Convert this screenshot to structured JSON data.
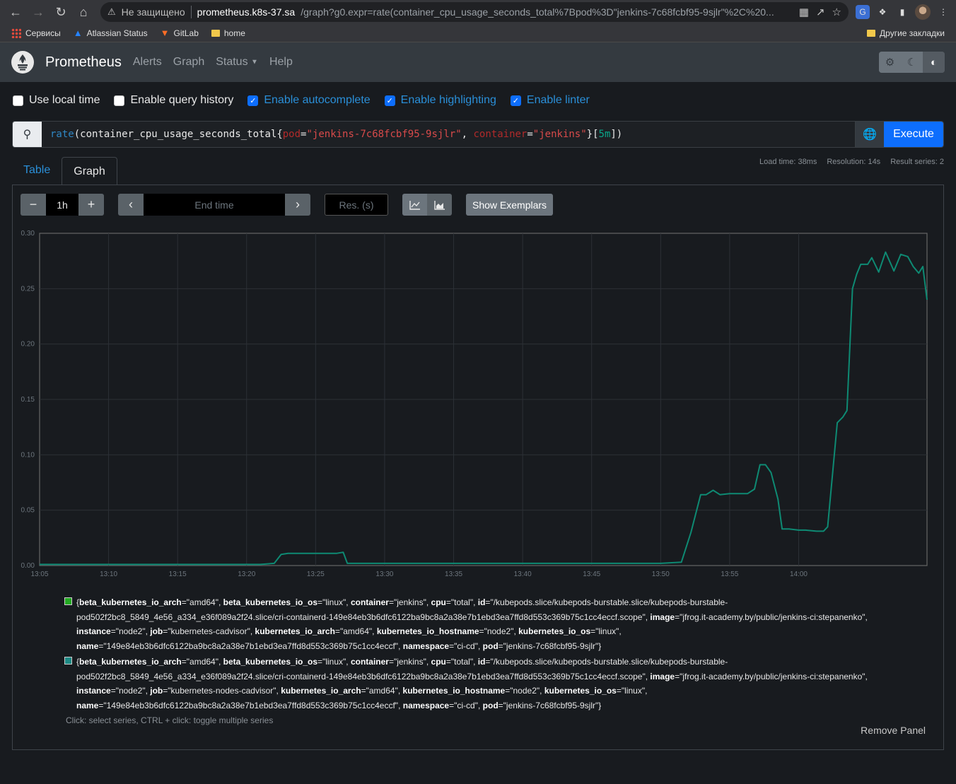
{
  "browser": {
    "insecure_label": "Не защищено",
    "host": "prometheus.k8s-37.sa",
    "path": "/graph?g0.expr=rate(container_cpu_usage_seconds_total%7Bpod%3D\"jenkins-7c68fcbf95-9sjlr\"%2C%20...",
    "bookmarks": [
      "Сервисы",
      "Atlassian Status",
      "GitLab",
      "home"
    ],
    "other_bookmarks": "Другие закладки"
  },
  "navbar": {
    "brand": "Prometheus",
    "links": [
      "Alerts",
      "Graph",
      "Status",
      "Help"
    ]
  },
  "options": [
    {
      "label": "Use local time",
      "checked": false
    },
    {
      "label": "Enable query history",
      "checked": false
    },
    {
      "label": "Enable autocomplete",
      "checked": true
    },
    {
      "label": "Enable highlighting",
      "checked": true
    },
    {
      "label": "Enable linter",
      "checked": true
    }
  ],
  "query": {
    "fn": "rate",
    "metric": "container_cpu_usage_seconds_total",
    "label1": "pod",
    "value1": "\"jenkins-7c68fcbf95-9sjlr\"",
    "label2": "container",
    "value2": "\"jenkins\"",
    "range": "5m",
    "execute_label": "Execute"
  },
  "tabs": {
    "table": "Table",
    "graph": "Graph"
  },
  "stats": {
    "load_time": "Load time: 38ms",
    "resolution": "Resolution: 14s",
    "result_series": "Result series: 2"
  },
  "controls": {
    "range": "1h",
    "end_time_placeholder": "End time",
    "res_placeholder": "Res. (s)",
    "show_exemplars": "Show Exemplars"
  },
  "chart_data": {
    "type": "line",
    "x_tick_labels": [
      "13:05",
      "13:10",
      "13:15",
      "13:20",
      "13:25",
      "13:30",
      "13:35",
      "13:40",
      "13:45",
      "13:50",
      "13:55",
      "14:00"
    ],
    "y_tick_labels": [
      "0.00",
      "0.05",
      "0.10",
      "0.15",
      "0.20",
      "0.25",
      "0.30"
    ],
    "ylim": [
      0,
      0.3
    ],
    "x_unit": "minutes after 13:05",
    "series": [
      {
        "color": "#0e8a73",
        "points": [
          [
            0,
            0.001
          ],
          [
            5,
            0.001
          ],
          [
            10,
            0.001
          ],
          [
            15,
            0.001
          ],
          [
            16,
            0.001
          ],
          [
            17,
            0.002
          ],
          [
            17.5,
            0.01
          ],
          [
            18,
            0.011
          ],
          [
            20,
            0.011
          ],
          [
            21.5,
            0.011
          ],
          [
            22,
            0.012
          ],
          [
            22.3,
            0.002
          ],
          [
            25,
            0.002
          ],
          [
            30,
            0.002
          ],
          [
            35,
            0.002
          ],
          [
            40,
            0.002
          ],
          [
            45,
            0.002
          ],
          [
            46.5,
            0.003
          ],
          [
            47.2,
            0.03
          ],
          [
            47.9,
            0.064
          ],
          [
            48.3,
            0.064
          ],
          [
            48.8,
            0.068
          ],
          [
            49.3,
            0.064
          ],
          [
            50,
            0.065
          ],
          [
            51.3,
            0.065
          ],
          [
            51.8,
            0.069
          ],
          [
            52.2,
            0.091
          ],
          [
            52.6,
            0.091
          ],
          [
            53,
            0.084
          ],
          [
            53.5,
            0.06
          ],
          [
            53.8,
            0.033
          ],
          [
            54.3,
            0.033
          ],
          [
            55,
            0.032
          ],
          [
            55.5,
            0.032
          ],
          [
            56.3,
            0.031
          ],
          [
            56.8,
            0.031
          ],
          [
            57.1,
            0.035
          ],
          [
            57.8,
            0.129
          ],
          [
            58.2,
            0.134
          ],
          [
            58.5,
            0.14
          ],
          [
            58.9,
            0.25
          ],
          [
            59.2,
            0.263
          ],
          [
            59.5,
            0.272
          ],
          [
            60,
            0.272
          ],
          [
            60.3,
            0.278
          ],
          [
            60.8,
            0.265
          ],
          [
            61.3,
            0.283
          ],
          [
            61.9,
            0.266
          ],
          [
            62.4,
            0.281
          ],
          [
            62.9,
            0.279
          ],
          [
            63.3,
            0.27
          ],
          [
            63.7,
            0.264
          ],
          [
            64,
            0.27
          ],
          [
            64.3,
            0.24
          ]
        ]
      }
    ]
  },
  "legend": [
    {
      "color": "#22aa22",
      "parts": [
        [
          "beta_kubernetes_io_arch",
          "\"amd64\""
        ],
        [
          "beta_kubernetes_io_os",
          "\"linux\""
        ],
        [
          "container",
          "\"jenkins\""
        ],
        [
          "cpu",
          "\"total\""
        ],
        [
          "id",
          "\"/kubepods.slice/kubepods-burstable.slice/kubepods-burstable-pod502f2bc8_5849_4e56_a334_e36f089a2f24.slice/cri-containerd-149e84eb3b6dfc6122ba9bc8a2a38e7b1ebd3ea7ffd8d553c369b75c1cc4eccf.scope\""
        ],
        [
          "image",
          "\"jfrog.it-academy.by/public/jenkins-ci:stepanenko\""
        ],
        [
          "instance",
          "\"node2\""
        ],
        [
          "job",
          "\"kubernetes-cadvisor\""
        ],
        [
          "kubernetes_io_arch",
          "\"amd64\""
        ],
        [
          "kubernetes_io_hostname",
          "\"node2\""
        ],
        [
          "kubernetes_io_os",
          "\"linux\""
        ],
        [
          "name",
          "\"149e84eb3b6dfc6122ba9bc8a2a38e7b1ebd3ea7ffd8d553c369b75c1cc4eccf\""
        ],
        [
          "namespace",
          "\"ci-cd\""
        ],
        [
          "pod",
          "\"jenkins-7c68fcbf95-9sjlr\""
        ]
      ]
    },
    {
      "color": "#1c8a84",
      "parts": [
        [
          "beta_kubernetes_io_arch",
          "\"amd64\""
        ],
        [
          "beta_kubernetes_io_os",
          "\"linux\""
        ],
        [
          "container",
          "\"jenkins\""
        ],
        [
          "cpu",
          "\"total\""
        ],
        [
          "id",
          "\"/kubepods.slice/kubepods-burstable.slice/kubepods-burstable-pod502f2bc8_5849_4e56_a334_e36f089a2f24.slice/cri-containerd-149e84eb3b6dfc6122ba9bc8a2a38e7b1ebd3ea7ffd8d553c369b75c1cc4eccf.scope\""
        ],
        [
          "image",
          "\"jfrog.it-academy.by/public/jenkins-ci:stepanenko\""
        ],
        [
          "instance",
          "\"node2\""
        ],
        [
          "job",
          "\"kubernetes-nodes-cadvisor\""
        ],
        [
          "kubernetes_io_arch",
          "\"amd64\""
        ],
        [
          "kubernetes_io_hostname",
          "\"node2\""
        ],
        [
          "kubernetes_io_os",
          "\"linux\""
        ],
        [
          "name",
          "\"149e84eb3b6dfc6122ba9bc8a2a38e7b1ebd3ea7ffd8d553c369b75c1cc4eccf\""
        ],
        [
          "namespace",
          "\"ci-cd\""
        ],
        [
          "pod",
          "\"jenkins-7c68fcbf95-9sjlr\""
        ]
      ]
    }
  ],
  "hint": "Click: select series, CTRL + click: toggle multiple series",
  "remove_panel": "Remove Panel"
}
